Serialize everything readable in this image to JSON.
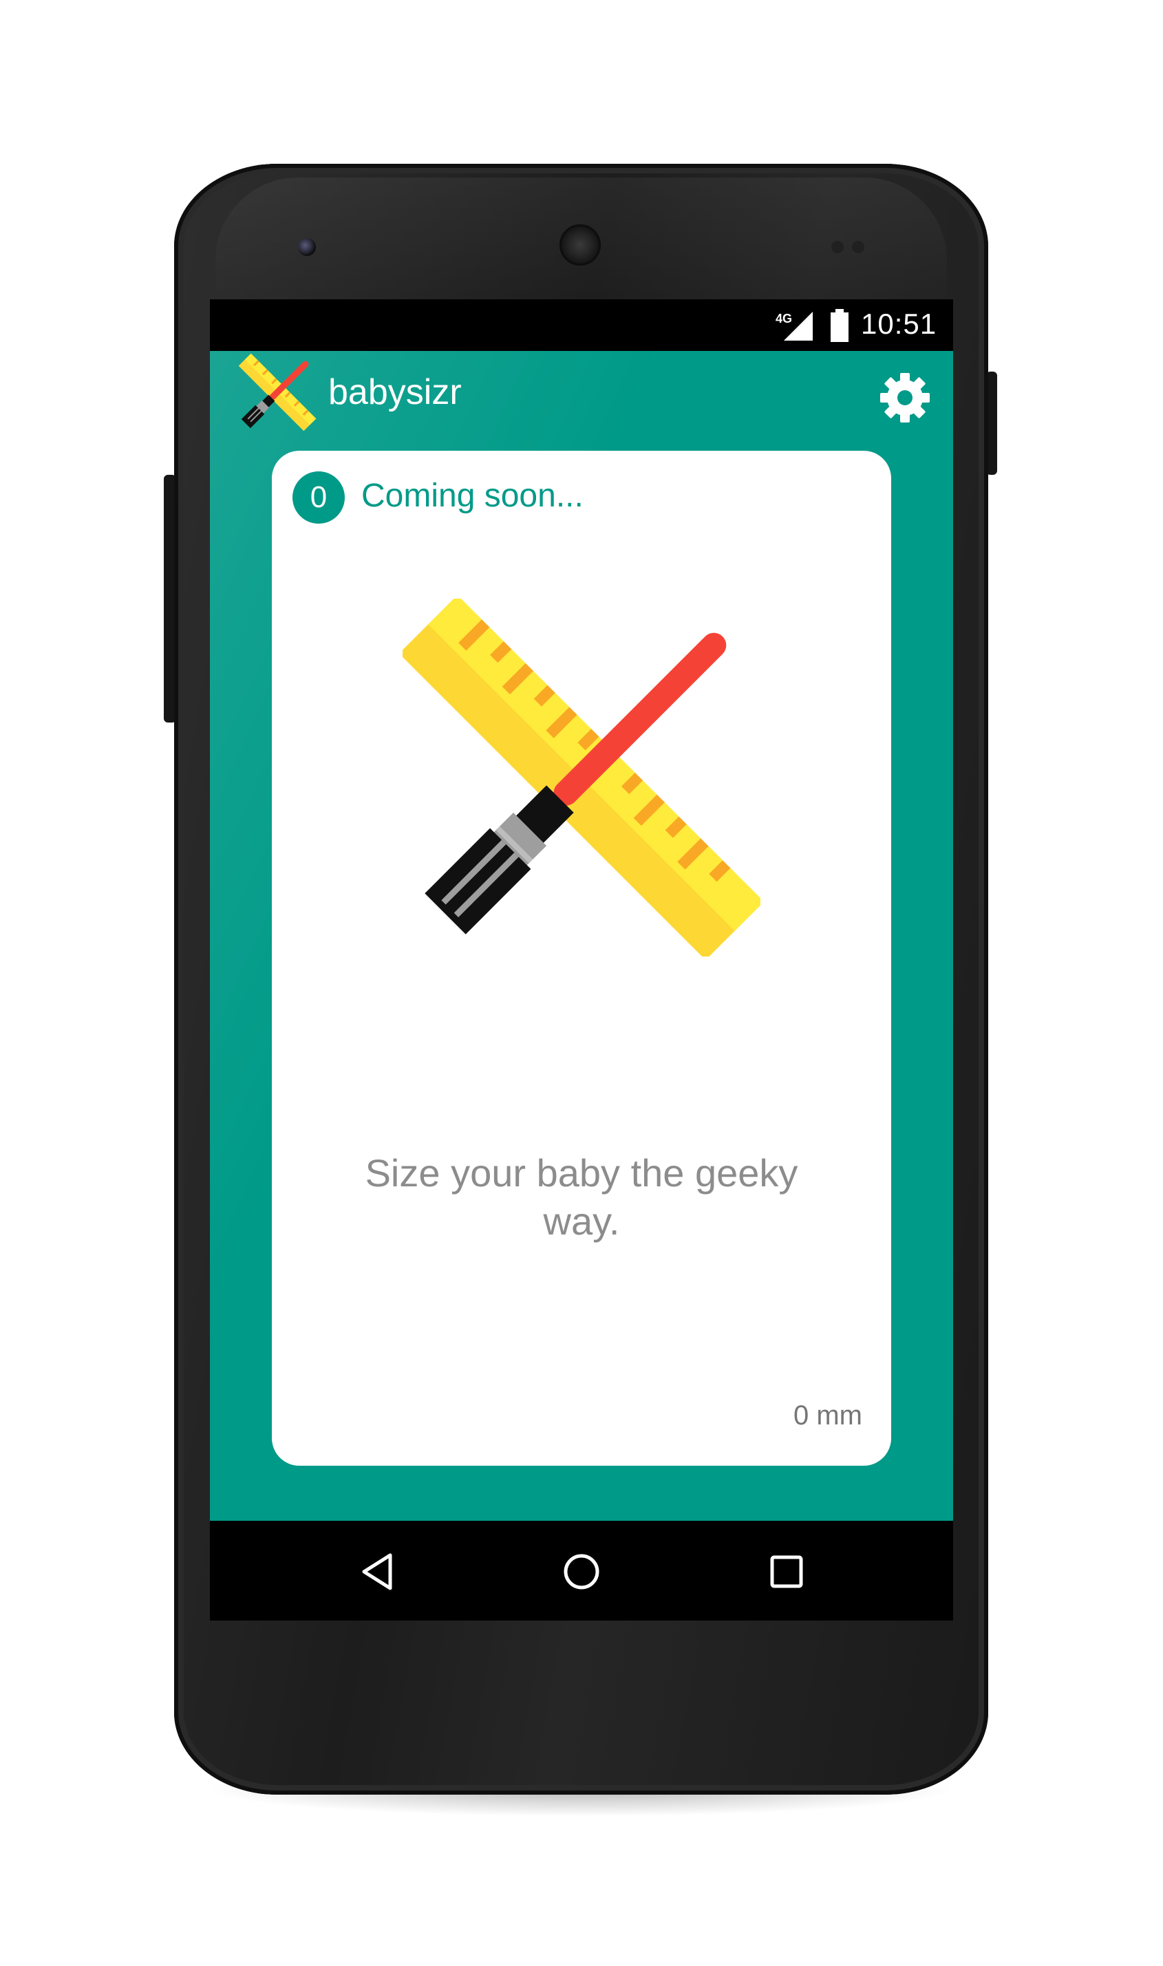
{
  "status_bar": {
    "network": "4G",
    "time": "10:51"
  },
  "app": {
    "title": "babysizr",
    "logo_icon": "ruler-lightsaber-logo-icon",
    "settings_icon": "gear-icon",
    "accent_color": "#009a88"
  },
  "card": {
    "count": "0",
    "status": "Coming soon...",
    "illustration_icon": "ruler-lightsaber-icon",
    "tagline": "Size your baby the geeky way.",
    "measurement": "0 mm"
  },
  "nav": {
    "back_icon": "back-triangle-icon",
    "home_icon": "home-circle-icon",
    "recents_icon": "recents-square-icon"
  }
}
